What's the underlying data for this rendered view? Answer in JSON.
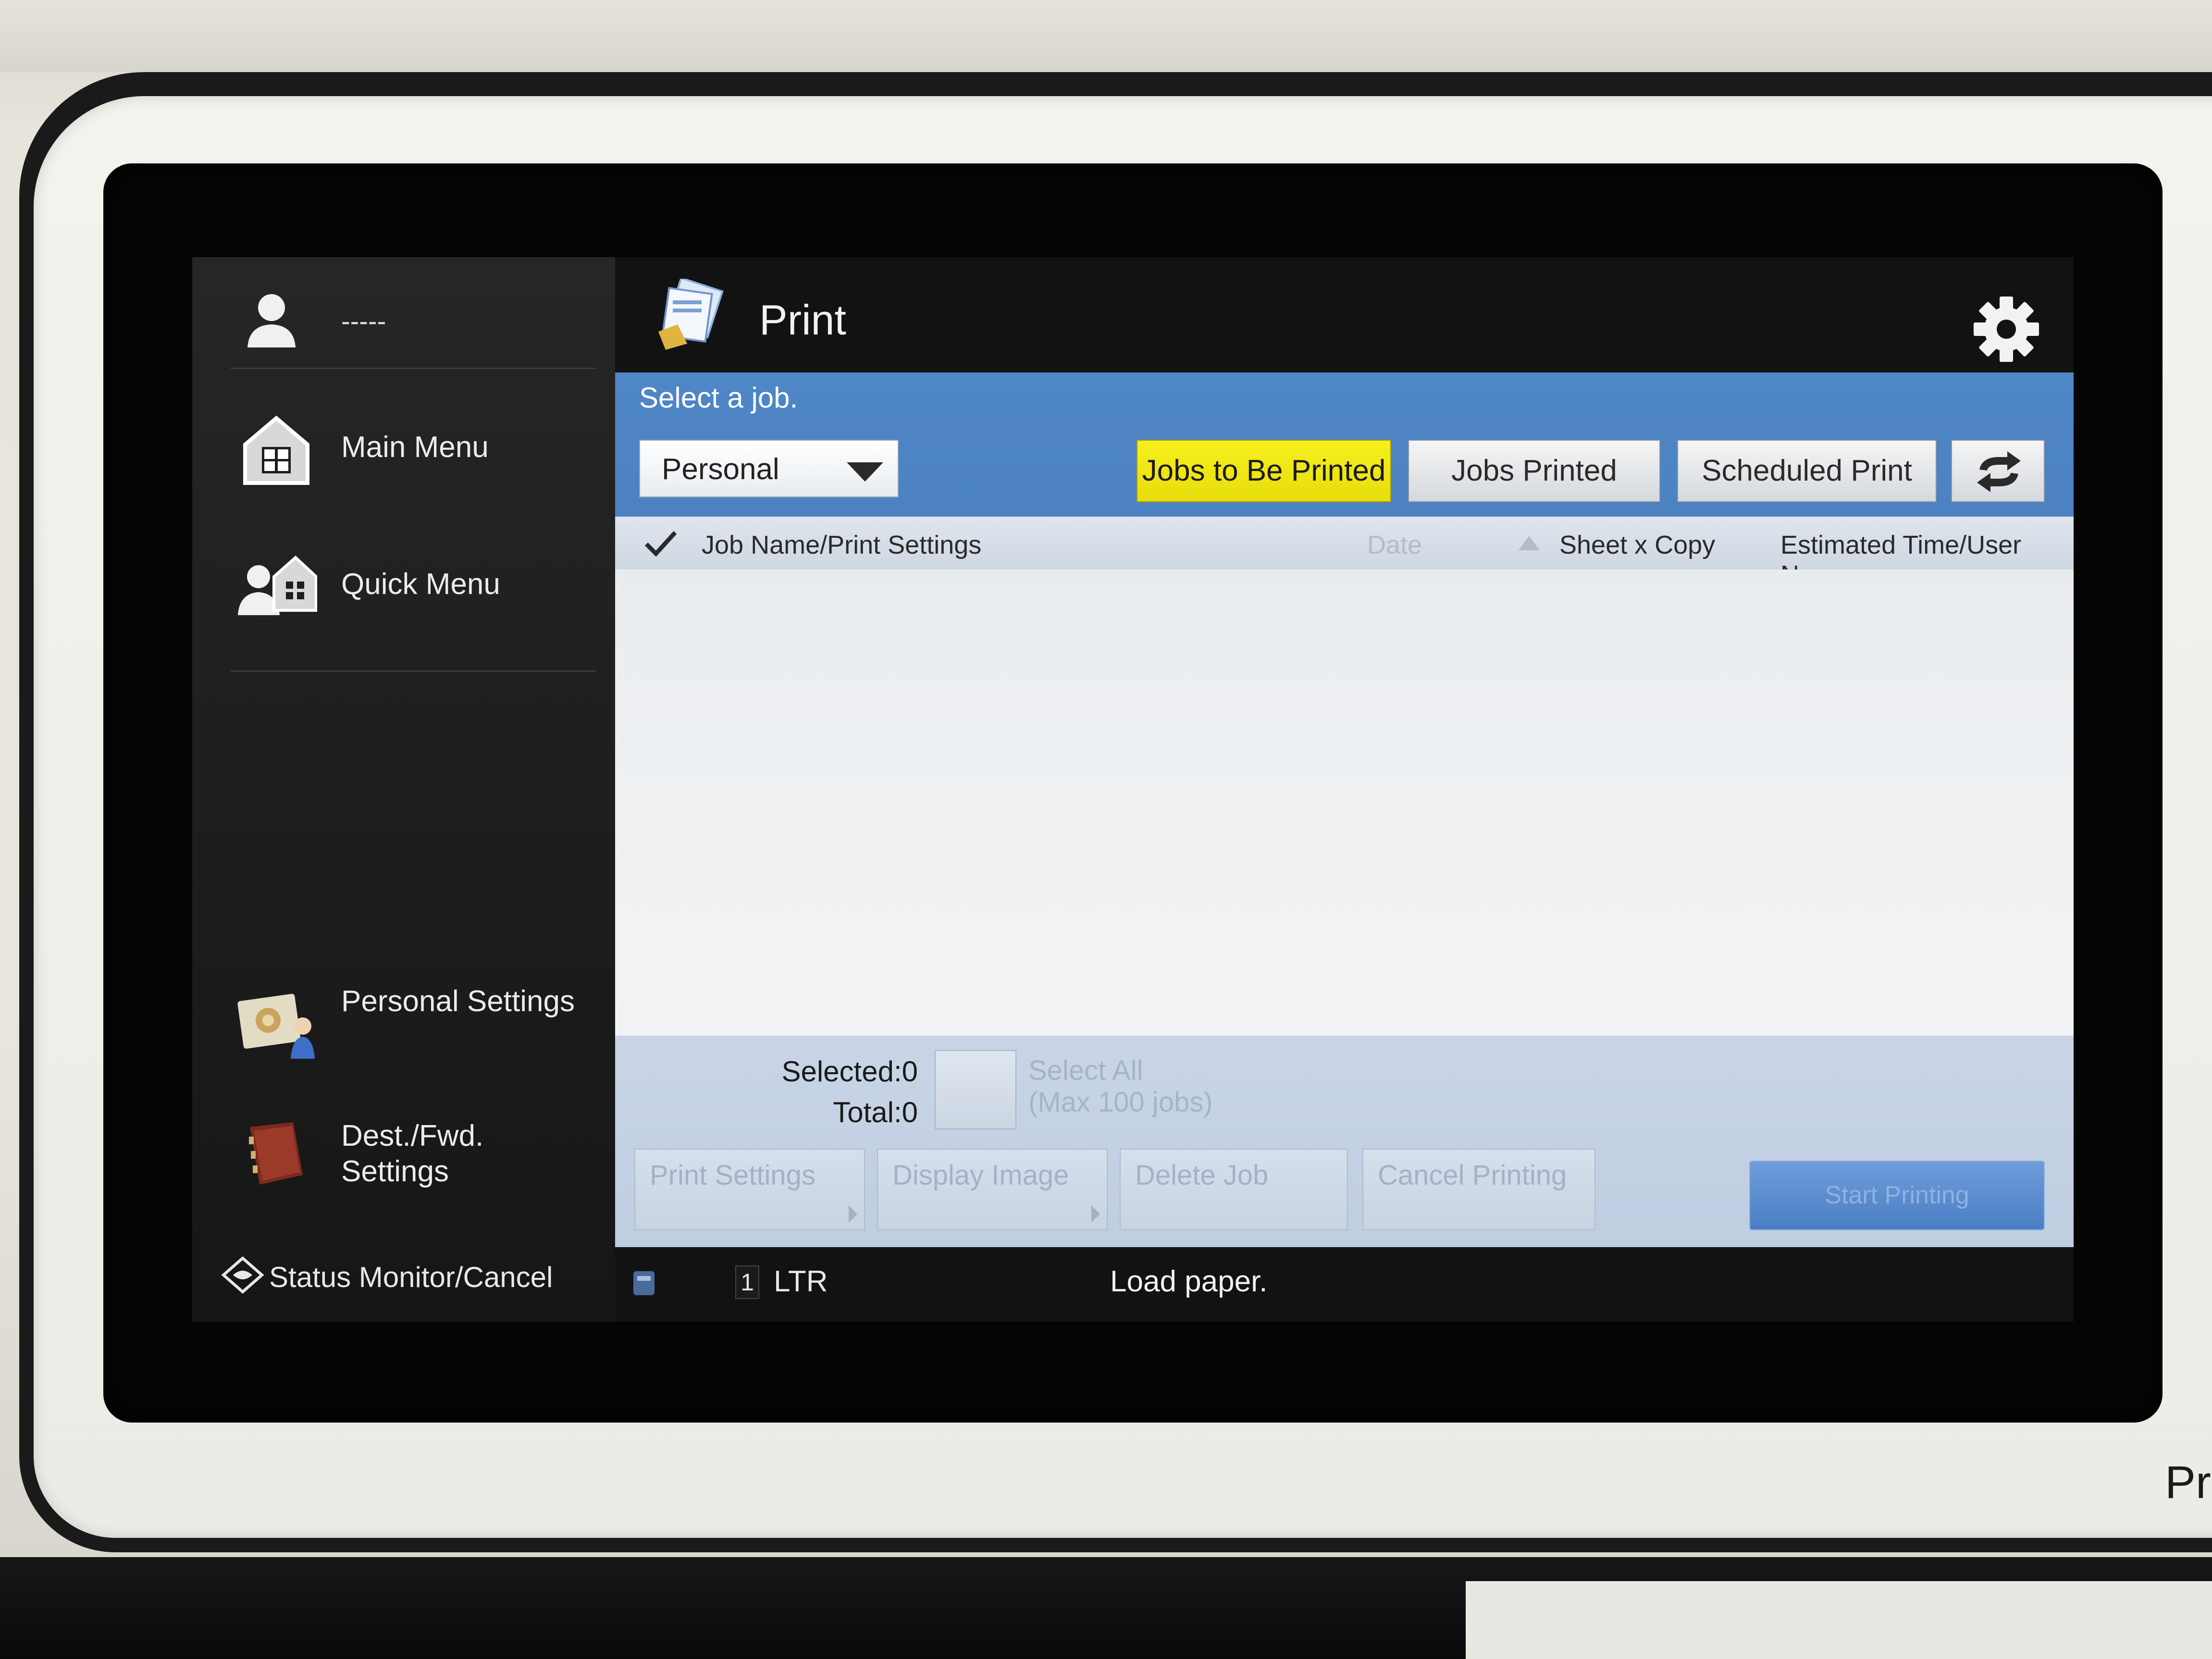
{
  "user": {
    "name": "-----"
  },
  "sidebar": {
    "items": [
      {
        "label": "Main Menu",
        "icon": "home-icon"
      },
      {
        "label": "Quick Menu",
        "icon": "quick-menu-icon"
      },
      {
        "label": "Personal Settings",
        "icon": "personal-settings-icon"
      },
      {
        "label": "Dest./Fwd. Settings",
        "icon": "address-book-icon"
      }
    ],
    "status_monitor": "Status Monitor/Cancel"
  },
  "header": {
    "title": "Print",
    "icon": "print-icon",
    "settings_icon": "gear-icon"
  },
  "instruction": "Select a job.",
  "filter": {
    "selected": "Personal"
  },
  "tabs": [
    {
      "label": "Jobs to Be Printed",
      "active": true
    },
    {
      "label": "Jobs Printed",
      "active": false
    },
    {
      "label": "Scheduled Print",
      "active": false
    }
  ],
  "refresh_icon": "refresh-icon",
  "columns": {
    "name": "Job Name/Print Settings",
    "date": "Date",
    "sheets": "Sheet x Copy",
    "estimate": "Estimated Time/User Name"
  },
  "jobs": [],
  "selection": {
    "selected": "Selected:0",
    "total": "Total:0",
    "select_all_line1": "Select All",
    "select_all_line2": "(Max 100 jobs)"
  },
  "actions": {
    "print_settings": "Print Settings",
    "display_image": "Display Image",
    "delete_job": "Delete Job",
    "cancel_printing": "Cancel Printing",
    "start_printing": "Start Printing"
  },
  "status_bar": {
    "tray_number": "1",
    "paper": "LTR",
    "message": "Load paper."
  },
  "device_label": "Pro",
  "colors": {
    "accent_blue": "#4f86c6",
    "active_tab_yellow": "#f2ea16",
    "sidebar_bg": "#1e1e1e"
  }
}
